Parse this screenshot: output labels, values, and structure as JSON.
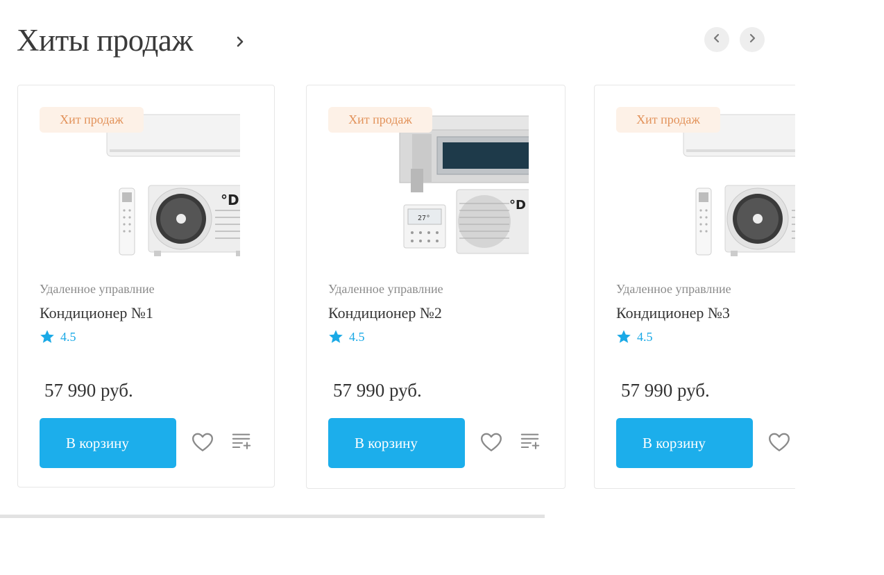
{
  "section": {
    "title": "Хиты продаж"
  },
  "icons": {
    "title_arrow": "chevron-right-icon",
    "prev": "chevron-left-icon",
    "next": "chevron-right-icon",
    "rating": "star-icon",
    "favorite": "heart-icon",
    "compare": "compare-list-icon"
  },
  "colors": {
    "accent": "#1caeeb",
    "badge_bg": "#fdf1e7",
    "badge_text": "#e2925a",
    "rating": "#1aa9e6",
    "nav_bg": "#eeeeee"
  },
  "products": [
    {
      "badge": "Хит продаж",
      "category": "Удаленное управлние",
      "name": "Кондиционер №1",
      "rating": "4.5",
      "price": "57 990 руб.",
      "cart_label": "В корзину",
      "image": "wall-split-air-conditioner"
    },
    {
      "badge": "Хит продаж",
      "category": "Удаленное управлние",
      "name": "Кондиционер №2",
      "rating": "4.5",
      "price": "57 990 руб.",
      "cart_label": "В корзину",
      "image": "ducted-air-conditioner"
    },
    {
      "badge": "Хит продаж",
      "category": "Удаленное управлние",
      "name": "Кондиционер №3",
      "rating": "4.5",
      "price": "57 990 руб.",
      "cart_label": "В корзину",
      "image": "wall-split-air-conditioner"
    }
  ]
}
